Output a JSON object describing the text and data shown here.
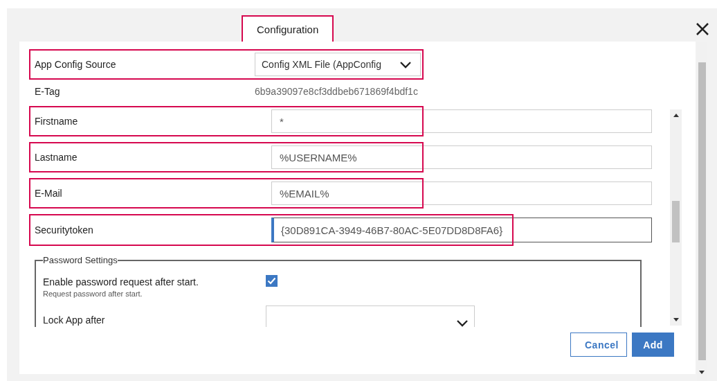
{
  "tabs": [
    {
      "label": "Configuration",
      "selected": true,
      "highlighted": true
    }
  ],
  "fields": [
    {
      "kind": "select",
      "label": "App Config Source",
      "value": "Config XML File (AppConfig",
      "highlighted": true
    },
    {
      "kind": "info",
      "label": "E-Tag",
      "value": "6b9a39097e8cf3ddbeb671869f4bdf1c"
    },
    {
      "kind": "text",
      "label": "Firstname",
      "value": "*",
      "highlighted": true,
      "focused": false
    },
    {
      "kind": "text",
      "label": "Lastname",
      "value": "%USERNAME%",
      "highlighted": true,
      "focused": false
    },
    {
      "kind": "text",
      "label": "E-Mail",
      "value": "%EMAIL%",
      "highlighted": true,
      "focused": false
    },
    {
      "kind": "text",
      "label": "Securitytoken",
      "value": "{30D891CA-3949-46B7-80AC-5E07DD8D8FA6}",
      "highlighted": true,
      "focused": true
    }
  ],
  "password_settings": {
    "title": "Password Settings",
    "items": [
      {
        "kind": "checkbox",
        "label": "Enable password request after start.",
        "hint": "Request password after start.",
        "checked": true
      },
      {
        "kind": "select",
        "label": "Lock App after"
      }
    ]
  },
  "buttons": [
    {
      "label": "Cancel",
      "kind": "secondary"
    },
    {
      "label": "Add",
      "kind": "primary"
    }
  ]
}
